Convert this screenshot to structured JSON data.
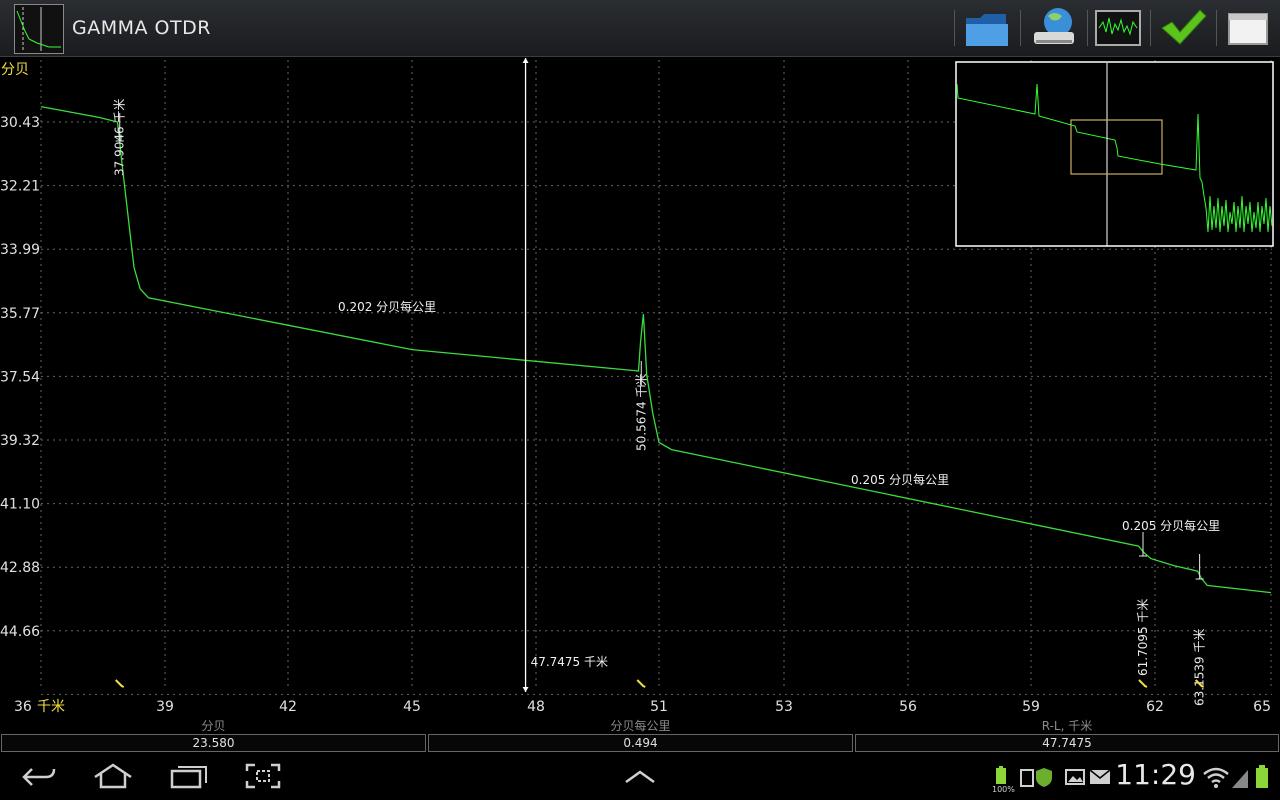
{
  "app": {
    "title": "GAMMA OTDR"
  },
  "toolbar": [
    {
      "icon": "folder-icon"
    },
    {
      "icon": "network-drive-icon"
    },
    {
      "icon": "trace-view-icon"
    },
    {
      "icon": "checkmark-icon"
    },
    {
      "icon": "window-icon"
    }
  ],
  "plot": {
    "y_unit": "分贝",
    "x_unit": "千米",
    "y_ticks": [
      "30.43",
      "32.21",
      "33.99",
      "35.77",
      "37.54",
      "39.32",
      "41.10",
      "42.88",
      "44.66"
    ],
    "x_ticks": [
      "36",
      "39",
      "42",
      "45",
      "48",
      "51",
      "53",
      "56",
      "59",
      "62",
      "65"
    ],
    "cursor_label": "47.7475 千米",
    "cursor_km": 47.7475,
    "events": [
      {
        "km": 37.9046,
        "label": "37.9046 千米"
      },
      {
        "km": 50.5674,
        "label": "50.5674 千米"
      },
      {
        "km": 61.7095,
        "label": "61.7095 千米"
      },
      {
        "km": 63.1539,
        "label": "63.1539 千米"
      }
    ],
    "slopes": [
      {
        "label": "0.202 分贝每公里"
      },
      {
        "label": "0.205 分贝每公里"
      },
      {
        "label": "0.205 分贝每公里"
      }
    ]
  },
  "chart_data": {
    "type": "line",
    "xlabel": "千米",
    "ylabel": "分贝",
    "xlim": [
      36,
      65
    ],
    "ylim": [
      30.43,
      44.66
    ],
    "y_inverted": true,
    "series": [
      {
        "values_x": [
          36.0,
          37.4,
          37.85,
          37.95,
          38.1,
          38.25,
          38.4,
          38.6,
          45.0,
          50.5,
          50.55,
          50.62,
          50.7,
          50.85,
          51.0,
          51.2,
          61.6,
          61.75,
          61.9,
          62.5,
          63.1,
          63.2,
          63.35,
          65.0
        ],
        "values_y": [
          30.0,
          30.3,
          30.43,
          31.5,
          33.0,
          34.5,
          35.1,
          35.35,
          36.8,
          37.4,
          36.6,
          35.8,
          37.5,
          38.6,
          39.4,
          39.6,
          42.3,
          42.5,
          42.65,
          42.85,
          43.0,
          43.2,
          43.4,
          43.6
        ]
      }
    ]
  },
  "stats": [
    {
      "label": "分贝",
      "value": "23.580"
    },
    {
      "label": "分贝每公里",
      "value": "0.494"
    },
    {
      "label": "R-L, 千米",
      "value": "47.7475"
    }
  ],
  "statusbar": {
    "time": "11:29",
    "battery": "100%"
  },
  "nav": [
    {
      "icon": "back-icon"
    },
    {
      "icon": "home-icon"
    },
    {
      "icon": "recent-apps-icon"
    },
    {
      "icon": "screenshot-icon"
    },
    {
      "icon": "chevron-up-icon"
    }
  ]
}
